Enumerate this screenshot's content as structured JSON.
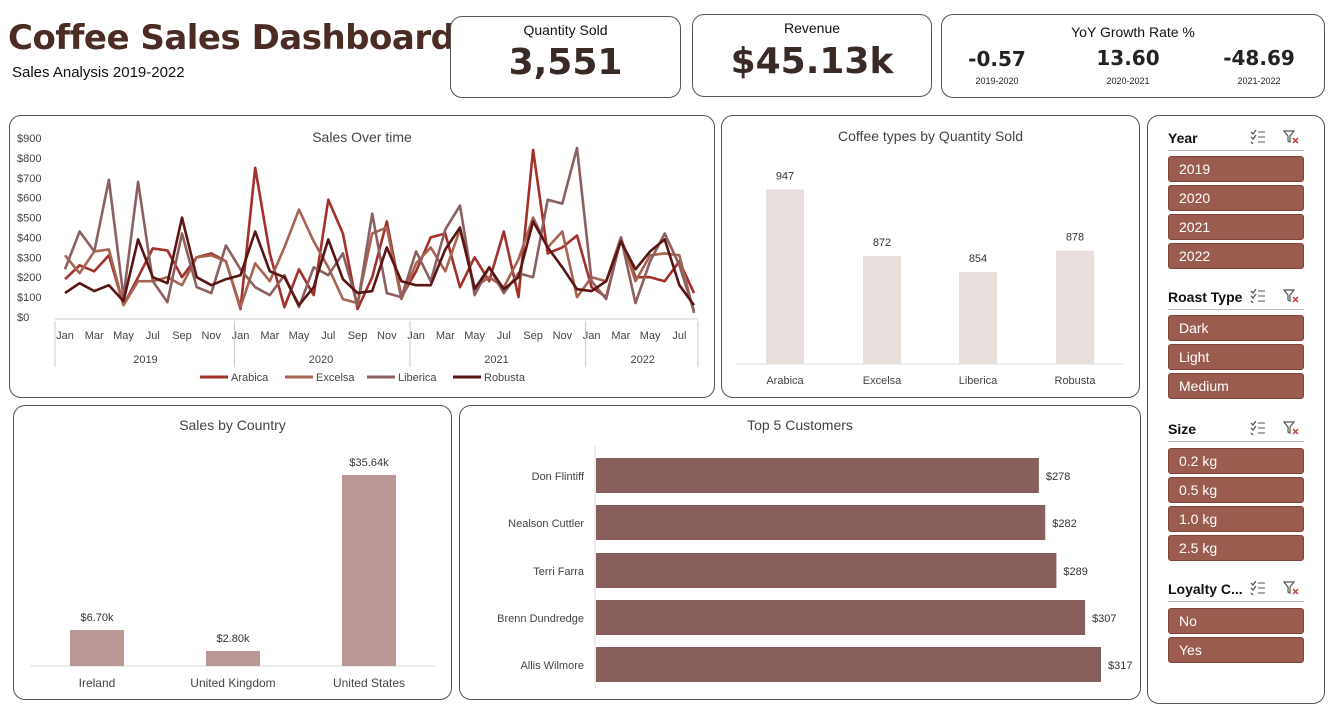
{
  "header": {
    "title": "Coffee Sales Dashboard",
    "subtitle": "Sales Analysis 2019-2022"
  },
  "kpis": {
    "quantity": {
      "label": "Quantity Sold",
      "value": "3,551"
    },
    "revenue": {
      "label": "Revenue",
      "value": "$45.13k"
    },
    "yoy": {
      "label": "YoY  Growth Rate %",
      "items": [
        {
          "value": "-0.57",
          "period": "2019-2020"
        },
        {
          "value": "13.60",
          "period": "2020-2021"
        },
        {
          "value": "-48.69",
          "period": "2021-2022"
        }
      ]
    }
  },
  "sales_over_time": {
    "title": "Sales Over time",
    "y_ticks": [
      "$0",
      "$100",
      "$200",
      "$300",
      "$400",
      "$500",
      "$600",
      "$700",
      "$800",
      "$900"
    ],
    "month_ticks": [
      "Jan",
      "Mar",
      "May",
      "Jul",
      "Sep",
      "Nov",
      "Jan",
      "Mar",
      "May",
      "Jul",
      "Sep",
      "Nov",
      "Jan",
      "Mar",
      "May",
      "Jul",
      "Sep",
      "Nov",
      "Jan",
      "Mar",
      "May",
      "Jul"
    ],
    "years": [
      "2019",
      "2020",
      "2021",
      "2022"
    ]
  },
  "quantity_by_type": {
    "title": "Coffee types by Quantity Sold"
  },
  "sales_by_country": {
    "title": "Sales by Country"
  },
  "top_customers": {
    "title": "Top 5 Customers"
  },
  "slicers": {
    "year": {
      "title": "Year",
      "items": [
        "2019",
        "2020",
        "2021",
        "2022"
      ]
    },
    "roast": {
      "title": "Roast Type",
      "items": [
        "Dark",
        "Light",
        "Medium"
      ]
    },
    "size": {
      "title": "Size",
      "items": [
        "0.2 kg",
        "0.5 kg",
        "1.0 kg",
        "2.5 kg"
      ]
    },
    "loyalty": {
      "title": "Loyalty C...",
      "items": [
        "No",
        "Yes"
      ]
    }
  },
  "colors": {
    "arabica": "#a4302a",
    "excelsa": "#a86452",
    "liberica": "#8c6060",
    "robusta": "#5a1414",
    "bar_light": "#e8dedc",
    "bar_country": "#b99794",
    "bar_customer": "#875e5b",
    "slicer": "#9a5c4f"
  },
  "chart_data": [
    {
      "type": "line",
      "title": "Sales Over time",
      "x": [
        "2019-01",
        "2019-02",
        "2019-03",
        "2019-04",
        "2019-05",
        "2019-06",
        "2019-07",
        "2019-08",
        "2019-09",
        "2019-10",
        "2019-11",
        "2019-12",
        "2020-01",
        "2020-02",
        "2020-03",
        "2020-04",
        "2020-05",
        "2020-06",
        "2020-07",
        "2020-08",
        "2020-09",
        "2020-10",
        "2020-11",
        "2020-12",
        "2021-01",
        "2021-02",
        "2021-03",
        "2021-04",
        "2021-05",
        "2021-06",
        "2021-07",
        "2021-08",
        "2021-09",
        "2021-10",
        "2021-11",
        "2021-12",
        "2022-01",
        "2022-02",
        "2022-03",
        "2022-04",
        "2022-05",
        "2022-06",
        "2022-07",
        "2022-08"
      ],
      "series": [
        {
          "name": "Arabica",
          "values": [
            190,
            260,
            230,
            310,
            60,
            200,
            345,
            335,
            200,
            300,
            320,
            280,
            40,
            750,
            320,
            50,
            240,
            110,
            590,
            420,
            40,
            200,
            480,
            100,
            230,
            400,
            420,
            150,
            300,
            180,
            430,
            100,
            840,
            320,
            350,
            410,
            150,
            100,
            390,
            200,
            200,
            180,
            280,
            120
          ]
        },
        {
          "name": "Excelsa",
          "values": [
            310,
            220,
            330,
            340,
            60,
            180,
            180,
            200,
            160,
            300,
            310,
            280,
            50,
            270,
            180,
            350,
            540,
            380,
            250,
            90,
            70,
            420,
            450,
            90,
            270,
            350,
            230,
            440,
            150,
            200,
            150,
            290,
            500,
            350,
            430,
            100,
            200,
            180,
            400,
            180,
            310,
            320,
            310,
            20
          ]
        },
        {
          "name": "Liberica",
          "values": [
            240,
            430,
            330,
            690,
            100,
            680,
            180,
            75,
            420,
            150,
            120,
            360,
            240,
            150,
            110,
            210,
            50,
            250,
            210,
            320,
            60,
            520,
            120,
            100,
            330,
            180,
            440,
            560,
            110,
            250,
            120,
            220,
            200,
            590,
            570,
            850,
            180,
            90,
            400,
            70,
            280,
            420,
            260,
            30
          ]
        },
        {
          "name": "Robusta",
          "values": [
            120,
            170,
            130,
            160,
            80,
            390,
            200,
            170,
            500,
            200,
            160,
            190,
            210,
            430,
            230,
            200,
            60,
            150,
            390,
            190,
            120,
            130,
            350,
            180,
            160,
            160,
            340,
            450,
            140,
            250,
            140,
            200,
            480,
            350,
            250,
            140,
            130,
            180,
            380,
            240,
            330,
            390,
            160,
            60
          ]
        }
      ],
      "ylim": [
        0,
        900
      ],
      "legend": "bottom"
    },
    {
      "type": "bar",
      "title": "Coffee types by Quantity Sold",
      "categories": [
        "Arabica",
        "Excelsa",
        "Liberica",
        "Robusta"
      ],
      "values": [
        947,
        872,
        854,
        878
      ],
      "labels": [
        "947",
        "872",
        "854",
        "878"
      ],
      "ylim": [
        750,
        960
      ]
    },
    {
      "type": "bar",
      "title": "Sales by Country",
      "categories": [
        "Ireland",
        "United Kingdom",
        "United States"
      ],
      "values": [
        6.7,
        2.8,
        35.64
      ],
      "labels": [
        "$6.70k",
        "$2.80k",
        "$35.64k"
      ]
    },
    {
      "type": "bar",
      "orientation": "horizontal",
      "title": "Top 5 Customers",
      "categories": [
        "Don Flintiff",
        "Nealson Cuttler",
        "Terri Farra",
        "Brenn Dundredge",
        "Allis Wilmore"
      ],
      "values": [
        278,
        282,
        289,
        307,
        317
      ],
      "labels": [
        "$278",
        "$282",
        "$289",
        "$307",
        "$317"
      ]
    }
  ]
}
